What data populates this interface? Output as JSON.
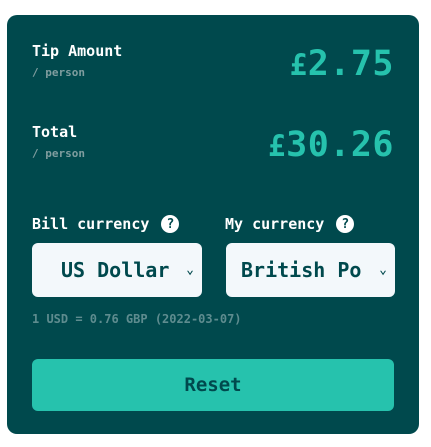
{
  "tip": {
    "label": "Tip Amount",
    "sub": "/ person",
    "currency_symbol": "£",
    "value": "2.75"
  },
  "total": {
    "label": "Total",
    "sub": "/ person",
    "currency_symbol": "£",
    "value": "30.26"
  },
  "bill_currency": {
    "label": "Bill currency",
    "selected": "US Dollar",
    "help_icon": "?"
  },
  "my_currency": {
    "label": "My currency",
    "selected": "British Po",
    "help_icon": "?"
  },
  "chevron_glyph": "⌄",
  "rate_text": "1 USD = 0.76 GBP (2022-03-07)",
  "reset_label": "Reset",
  "colors": {
    "card_bg": "#00494d",
    "accent": "#26c2ad",
    "input_bg": "#f3f8fb",
    "muted": "#7f9d9f"
  }
}
